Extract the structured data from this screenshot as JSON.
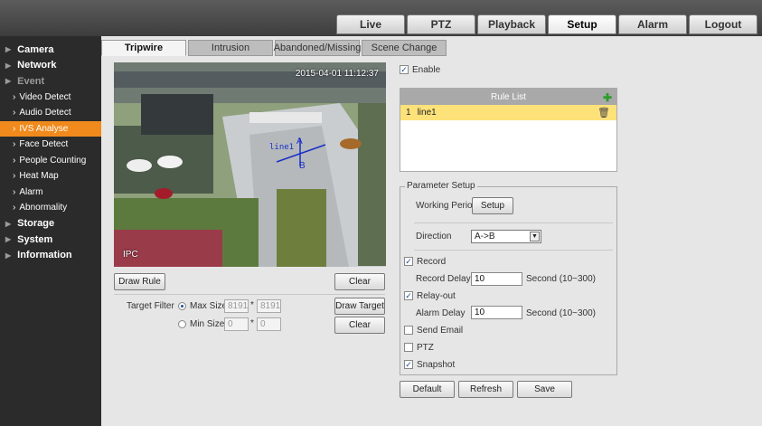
{
  "topnav": [
    "Live",
    "PTZ",
    "Playback",
    "Setup",
    "Alarm",
    "Logout"
  ],
  "topnav_active": "Setup",
  "help_icon": "?",
  "sidebar": [
    {
      "label": "Camera",
      "level": "top"
    },
    {
      "label": "Network",
      "level": "top"
    },
    {
      "label": "Event",
      "level": "top",
      "open": true
    },
    {
      "label": "Video Detect",
      "level": "sub"
    },
    {
      "label": "Audio Detect",
      "level": "sub"
    },
    {
      "label": "IVS Analyse",
      "level": "sub",
      "active": true
    },
    {
      "label": "Face Detect",
      "level": "sub"
    },
    {
      "label": "People Counting",
      "level": "sub"
    },
    {
      "label": "Heat Map",
      "level": "sub"
    },
    {
      "label": "Alarm",
      "level": "sub"
    },
    {
      "label": "Abnormality",
      "level": "sub"
    },
    {
      "label": "Storage",
      "level": "top"
    },
    {
      "label": "System",
      "level": "top"
    },
    {
      "label": "Information",
      "level": "top"
    }
  ],
  "subtabs": [
    "Tripwire",
    "Intrusion",
    "Abandoned/Missing",
    "Scene Change"
  ],
  "video": {
    "timestamp": "2015-04-01 11:12:37",
    "channel": "IPC",
    "rule_label": "line1",
    "point_a": "A",
    "point_b": "B"
  },
  "buttons": {
    "draw_rule": "Draw Rule",
    "clear1": "Clear",
    "draw_target": "Draw Target",
    "clear2": "Clear",
    "setup": "Setup",
    "default": "Default",
    "refresh": "Refresh",
    "save": "Save"
  },
  "target_filter": {
    "label": "Target Filter",
    "max_label": "Max Size",
    "max_w": "8191",
    "max_h": "8191",
    "min_label": "Min Size",
    "min_w": "0",
    "min_h": "0",
    "times": "*"
  },
  "enable_label": "Enable",
  "rule_list": {
    "header": "Rule List",
    "index": "1",
    "name": "line1"
  },
  "params": {
    "legend": "Parameter Setup",
    "working_period": "Working Period",
    "direction_label": "Direction",
    "direction_value": "A->B",
    "record": "Record",
    "record_delay": "Record Delay",
    "record_delay_value": "10",
    "record_unit": "Second (10~300)",
    "relay_out": "Relay-out",
    "alarm_delay": "Alarm Delay",
    "alarm_delay_value": "10",
    "alarm_unit": "Second (10~300)",
    "send_email": "Send Email",
    "ptz": "PTZ",
    "snapshot": "Snapshot"
  },
  "checked_mark": "✓",
  "colors": {
    "accent": "#f08a1c",
    "rule_highlight": "#fde27a",
    "tripline": "#1a2fc7"
  }
}
